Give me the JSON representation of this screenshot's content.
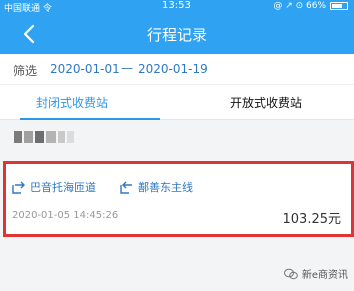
{
  "status_bar": {
    "carrier": "中国联通 令",
    "time": "13:53",
    "right_indicator": "@ ↗ ⊙ 66%"
  },
  "navbar": {
    "title": "行程记录",
    "back_icon": "chevron-left-icon"
  },
  "filter": {
    "label": "筛选",
    "start_date": "2020-01-01",
    "separator": "—",
    "end_date": "2020-01-19"
  },
  "tabs": [
    {
      "label": "封闭式收费站",
      "active": true
    },
    {
      "label": "开放式收费站",
      "active": false
    }
  ],
  "trip": {
    "entry_station": "巴音托海匝道",
    "exit_station": "鄯善东主线",
    "timestamp": "2020-01-05 14:45:26",
    "amount": "103.25元"
  },
  "watermark": {
    "text": "新e商资讯"
  },
  "colors": {
    "brand_blue": "#2fa3f1",
    "link_blue": "#2f78c4",
    "highlight_red": "#e03434"
  }
}
